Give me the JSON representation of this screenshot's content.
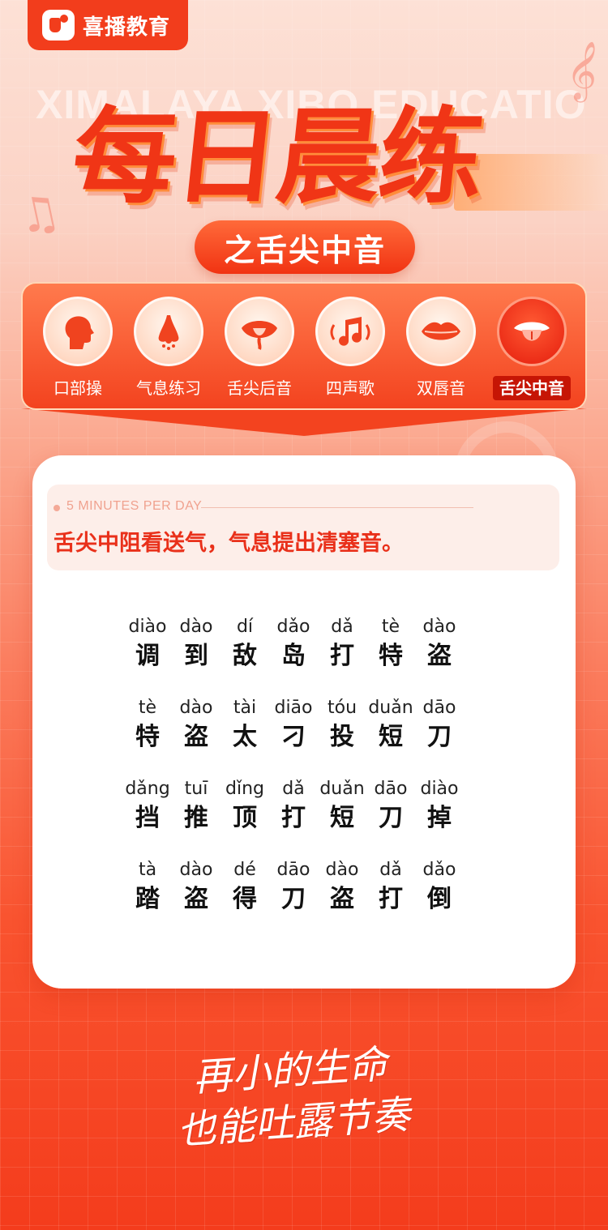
{
  "brand": {
    "name": "喜播教育"
  },
  "watermark": "XIMALAYA XIBO EDUCATION",
  "hero": {
    "title": "每日晨练",
    "subtitle": "之舌尖中音"
  },
  "categories": [
    {
      "label": "口部操",
      "icon": "head-profile-icon",
      "active": false
    },
    {
      "label": "气息练习",
      "icon": "nose-icon",
      "active": false
    },
    {
      "label": "舌尖后音",
      "icon": "tongue-mouth-icon",
      "active": false
    },
    {
      "label": "四声歌",
      "icon": "music-note-icon",
      "active": false
    },
    {
      "label": "双唇音",
      "icon": "lips-icon",
      "active": false
    },
    {
      "label": "舌尖中音",
      "icon": "tongue-out-icon",
      "active": true
    }
  ],
  "tip": {
    "en": "5 MINUTES PER DAY",
    "cn": "舌尖中阻看送气，气息提出清塞音。"
  },
  "rows": [
    [
      {
        "py": "diào",
        "hz": "调"
      },
      {
        "py": "dào",
        "hz": "到"
      },
      {
        "py": "dí",
        "hz": "敌"
      },
      {
        "py": "dǎo",
        "hz": "岛"
      },
      {
        "py": "dǎ",
        "hz": "打"
      },
      {
        "py": "tè",
        "hz": "特"
      },
      {
        "py": "dào",
        "hz": "盗"
      }
    ],
    [
      {
        "py": "tè",
        "hz": "特"
      },
      {
        "py": "dào",
        "hz": "盗"
      },
      {
        "py": "tài",
        "hz": "太"
      },
      {
        "py": "diāo",
        "hz": "刁"
      },
      {
        "py": "tóu",
        "hz": "投"
      },
      {
        "py": "duǎn",
        "hz": "短"
      },
      {
        "py": "dāo",
        "hz": "刀"
      }
    ],
    [
      {
        "py": "dǎng",
        "hz": "挡"
      },
      {
        "py": "tuī",
        "hz": "推"
      },
      {
        "py": "dǐng",
        "hz": "顶"
      },
      {
        "py": "dǎ",
        "hz": "打"
      },
      {
        "py": "duǎn",
        "hz": "短"
      },
      {
        "py": "dāo",
        "hz": "刀"
      },
      {
        "py": "diào",
        "hz": "掉"
      }
    ],
    [
      {
        "py": "tà",
        "hz": "踏"
      },
      {
        "py": "dào",
        "hz": "盗"
      },
      {
        "py": "dé",
        "hz": "得"
      },
      {
        "py": "dāo",
        "hz": "刀"
      },
      {
        "py": "dào",
        "hz": "盗"
      },
      {
        "py": "dǎ",
        "hz": "打"
      },
      {
        "py": "dǎo",
        "hz": "倒"
      }
    ]
  ],
  "slogan": {
    "line1": "再小的生命",
    "line2": "也能吐露节奏"
  },
  "colors": {
    "primary": "#f23d1c",
    "active_label_bg": "#c61505",
    "tip_text": "#e9301a"
  }
}
